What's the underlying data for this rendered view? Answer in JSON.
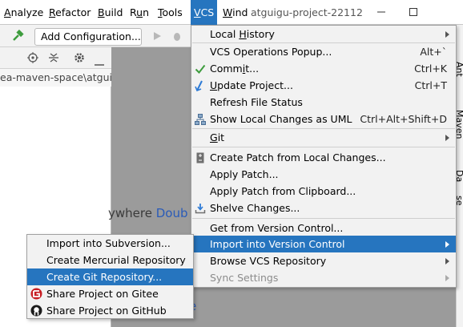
{
  "menubar": {
    "items": [
      "Analyze",
      "Refactor",
      "Build",
      "Run",
      "Tools",
      "VCS",
      "Wind"
    ],
    "underline": [
      "A",
      "R",
      "B",
      "u",
      "T",
      "V",
      "W"
    ],
    "title": "atguigu-project-22112"
  },
  "toolbar": {
    "add_config_label": "Add Configuration..."
  },
  "project": {
    "path": "ea-maven-space\\atguigu"
  },
  "editor": {
    "hint_prefix": "ywhere ",
    "hint_link": "Doub",
    "hint2": "e"
  },
  "right_strip": {
    "labels": [
      "Ant",
      "Maven",
      "Da",
      "se"
    ]
  },
  "vcs_menu": {
    "items": [
      {
        "label": "Local History",
        "shortcut": "",
        "submenu": true
      },
      {
        "label": "VCS Operations Popup...",
        "shortcut": "Alt+`",
        "submenu": false
      },
      {
        "label": "Commit...",
        "shortcut": "Ctrl+K",
        "submenu": false,
        "icon": "checkmark-icon"
      },
      {
        "label": "Update Project...",
        "shortcut": "Ctrl+T",
        "submenu": false,
        "icon": "update-arrow-icon"
      },
      {
        "label": "Refresh File Status",
        "shortcut": "",
        "submenu": false
      },
      {
        "label": "Show Local Changes as UML",
        "shortcut": "Ctrl+Alt+Shift+D",
        "submenu": false,
        "icon": "uml-diagram-icon"
      },
      {
        "label": "Git",
        "shortcut": "",
        "submenu": true
      },
      {
        "label": "Create Patch from Local Changes...",
        "shortcut": "",
        "submenu": false,
        "icon": "patch-file-icon"
      },
      {
        "label": "Apply Patch...",
        "shortcut": "",
        "submenu": false
      },
      {
        "label": "Apply Patch from Clipboard...",
        "shortcut": "",
        "submenu": false
      },
      {
        "label": "Shelve Changes...",
        "shortcut": "",
        "submenu": false,
        "icon": "shelve-icon"
      },
      {
        "label": "Get from Version Control...",
        "shortcut": "",
        "submenu": false
      },
      {
        "label": "Import into Version Control",
        "shortcut": "",
        "submenu": true,
        "highlighted": true
      },
      {
        "label": "Browse VCS Repository",
        "shortcut": "",
        "submenu": true
      },
      {
        "label": "Sync Settings",
        "shortcut": "",
        "submenu": true,
        "disabled": true
      }
    ]
  },
  "sub_menu": {
    "items": [
      {
        "label": "Import into Subversion..."
      },
      {
        "label": "Create Mercurial Repository"
      },
      {
        "label": "Create Git Repository...",
        "highlighted": true
      },
      {
        "label": "Share Project on Gitee",
        "icon": "gitee-logo-icon"
      },
      {
        "label": "Share Project on GitHub",
        "icon": "github-logo-icon"
      }
    ]
  },
  "colors": {
    "highlight": "#2675bf",
    "menu_bg": "#f2f2f2",
    "gitee_red": "#c71d23",
    "check_green": "#3d9c3d"
  }
}
